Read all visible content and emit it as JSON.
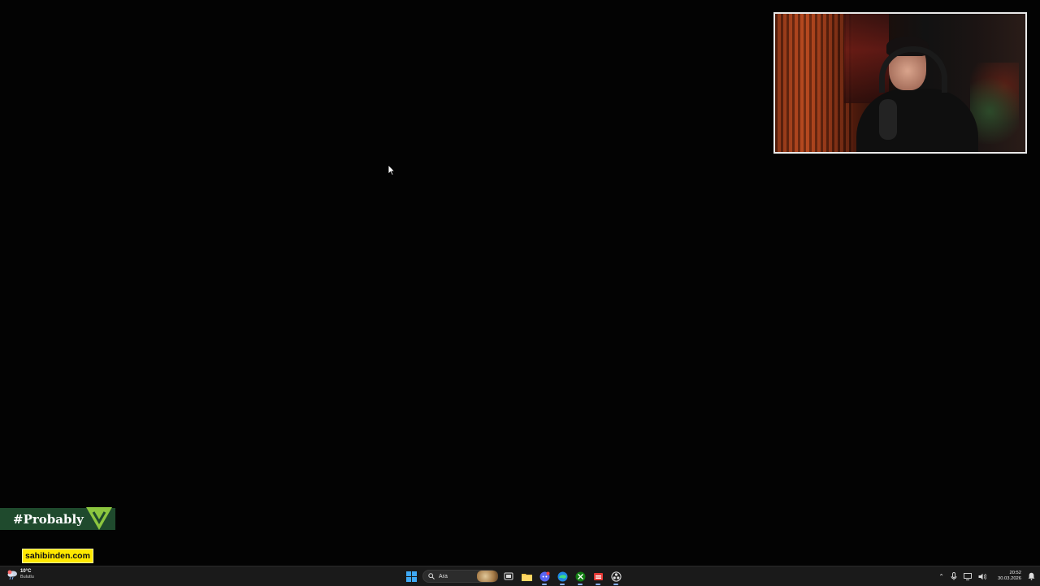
{
  "overlay": {
    "hashtag": "#Probably",
    "sponsor": "sahibinden.com"
  },
  "taskbar": {
    "weather": {
      "temperature": "10°C",
      "condition": "Bulutlu",
      "icon": "cloud-rain-icon"
    },
    "search": {
      "placeholder": "Ara"
    },
    "apps": [
      {
        "name": "start-button",
        "icon": "windows-logo-icon"
      },
      {
        "name": "task-view",
        "icon": "task-view-icon"
      },
      {
        "name": "file-explorer",
        "icon": "folder-icon"
      },
      {
        "name": "discord",
        "icon": "discord-icon"
      },
      {
        "name": "edge",
        "icon": "edge-icon"
      },
      {
        "name": "xbox",
        "icon": "xbox-icon"
      },
      {
        "name": "app-red",
        "icon": "red-app-icon"
      },
      {
        "name": "obs",
        "icon": "obs-icon"
      }
    ],
    "clock": {
      "time": "20:52",
      "date": "30.03.2026"
    }
  },
  "colors": {
    "background": "#030303",
    "taskbar": "#1a1a1a",
    "banner_green": "#1f4a2d",
    "logo_green": "#8cc63f",
    "sponsor_yellow": "#ffe800"
  }
}
